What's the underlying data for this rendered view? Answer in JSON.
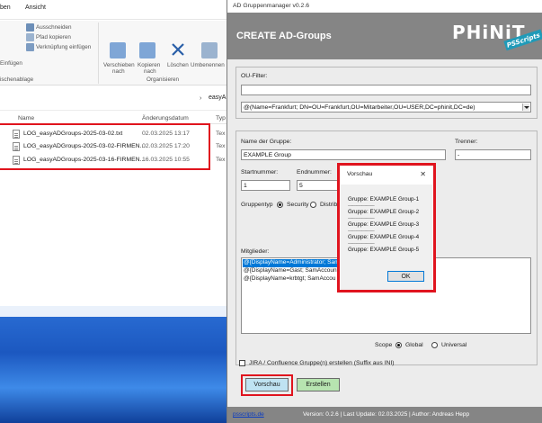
{
  "explorer": {
    "tabs": [
      "ben",
      "Ansicht"
    ],
    "ribbon": {
      "cut": "Ausschneiden",
      "copy_path": "Pfad kopieren",
      "paste_shortcut": "Verknüpfung einfügen",
      "paste": "Einfügen",
      "move_to": "Verschieben",
      "move_to_sub": "nach",
      "copy_to": "Kopieren",
      "copy_to_sub": "nach",
      "delete": "Löschen",
      "rename": "Umbenennen",
      "group_clipboard": "ischenablage",
      "group_organize": "Organisieren"
    },
    "address": "easyA",
    "columns": {
      "name": "Name",
      "date": "Änderungsdatum",
      "type": "Typ"
    },
    "files": [
      {
        "name": "LOG_easyADGroups-2025-03-02.txt",
        "date": "02.03.2025 13:17",
        "type": "Tex"
      },
      {
        "name": "LOG_easyADGroups-2025-03-02-FIRMEN...",
        "date": "02.03.2025 17:20",
        "type": "Tex"
      },
      {
        "name": "LOG_easyADGroups-2025-03-16-FIRMEN...",
        "date": "16.03.2025 10:55",
        "type": "Tex"
      }
    ]
  },
  "ad": {
    "window_title": "AD Gruppenmanager v0.2.6",
    "header": "CREATE AD-Groups",
    "logo_text": "PHiNiT",
    "logo_sub": "PSScripts",
    "ou_filter": {
      "label": "OU-Filter:",
      "input_value": "",
      "selected": "@(Name=Frankfurt; DN=OU=Frankfurt,OU=Mitarbeiter,OU=USER,DC=phinit,DC=de)"
    },
    "group_name": {
      "label": "Name der Gruppe:",
      "value": "EXAMPLE Group"
    },
    "separator": {
      "label": "Trenner:",
      "value": "-"
    },
    "start_number": {
      "label": "Startnummer:",
      "value": "1"
    },
    "end_number": {
      "label": "Endnummer:",
      "value": "5"
    },
    "group_type": {
      "label": "Gruppentyp",
      "security": "Security",
      "distribution": "Distribu"
    },
    "members": {
      "label": "Mitglieder:",
      "items": [
        "@{DisplayName=Administrator; Sam",
        "@{DisplayName=Gast; SamAccount",
        "@{DisplayName=krbtgt; SamAccou"
      ]
    },
    "scope": {
      "label": "Scope",
      "global": "Global",
      "universal": "Universal"
    },
    "jira_checkbox": "JIRA / Confluence Gruppe(n) erstellen (Suffix aus INI)",
    "buttons": {
      "preview": "Vorschau",
      "create": "Erstellen"
    },
    "footer": {
      "link": "psscripts.de",
      "version": "Version: 0.2.6 | Last Update: 02.03.2025 | Author: Andreas Hepp"
    }
  },
  "preview_dialog": {
    "title": "Vorschau",
    "close": "✕",
    "separator_line": "------------------------",
    "groups": [
      "Gruppe: EXAMPLE Group-1",
      "Gruppe: EXAMPLE Group-2",
      "Gruppe: EXAMPLE Group-3",
      "Gruppe: EXAMPLE Group-4",
      "Gruppe: EXAMPLE Group-5"
    ],
    "ok": "OK"
  },
  "colors": {
    "highlight": "#e0141e",
    "header_gray": "#858585",
    "preview_button": "#bfe3f2",
    "create_button": "#b7e4b0",
    "selection": "#0078d7"
  }
}
